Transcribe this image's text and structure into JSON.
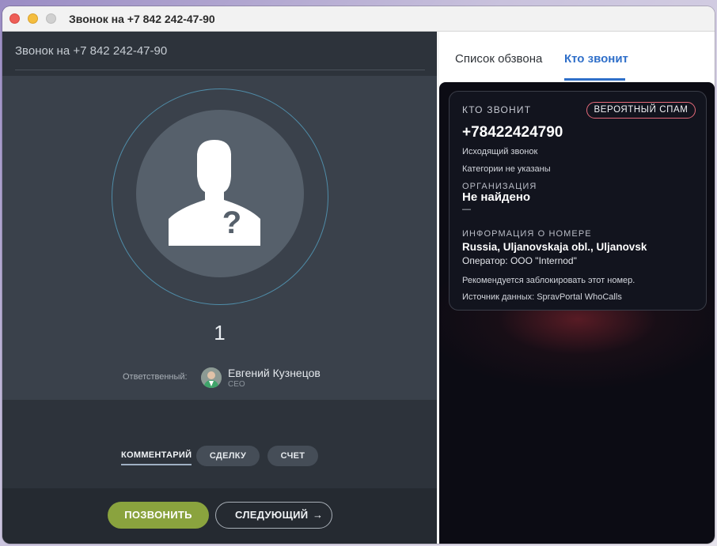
{
  "window": {
    "title": "Звонок на +7 842 242-47-90"
  },
  "left": {
    "header_title": "Звонок на +7 842 242-47-90",
    "count": "1",
    "responsible": {
      "label": "Ответственный:",
      "name": "Евгений Кузнецов",
      "role": "CEO"
    },
    "tabs": {
      "comment": "КОММЕНТАРИЙ",
      "deal": "СДЕЛКУ",
      "invoice": "СЧЕТ"
    },
    "buttons": {
      "call": "ПОЗВОНИТЬ",
      "next": "СЛЕДУЮЩИЙ",
      "next_arrow": "→"
    }
  },
  "right": {
    "tabs": {
      "call_list": "Список обзвона",
      "who_calls": "Кто звонит"
    },
    "card": {
      "heading": "КТО ЗВОНИТ",
      "badge": "ВЕРОЯТНЫЙ СПАМ",
      "phone": "+78422424790",
      "call_type": "Исходящий звонок",
      "categories": "Категории не указаны",
      "org_label": "ОРГАНИЗАЦИЯ",
      "org_value": "Не найдено",
      "org_dash": "—",
      "number_info_label": "ИНФОРМАЦИЯ О НОМЕРЕ",
      "location": "Russia, Uljanovskaja obl., Uljanovsk",
      "operator": "Оператор: ООО \"Internod\"",
      "recommendation": "Рекомендуется заблокировать этот номер.",
      "source": "Источник данных: SpravPortal WhoCalls"
    }
  },
  "colors": {
    "accent_blue": "#2f6fc9",
    "call_green": "#8aa33e",
    "spam_border": "#e56a7a"
  }
}
